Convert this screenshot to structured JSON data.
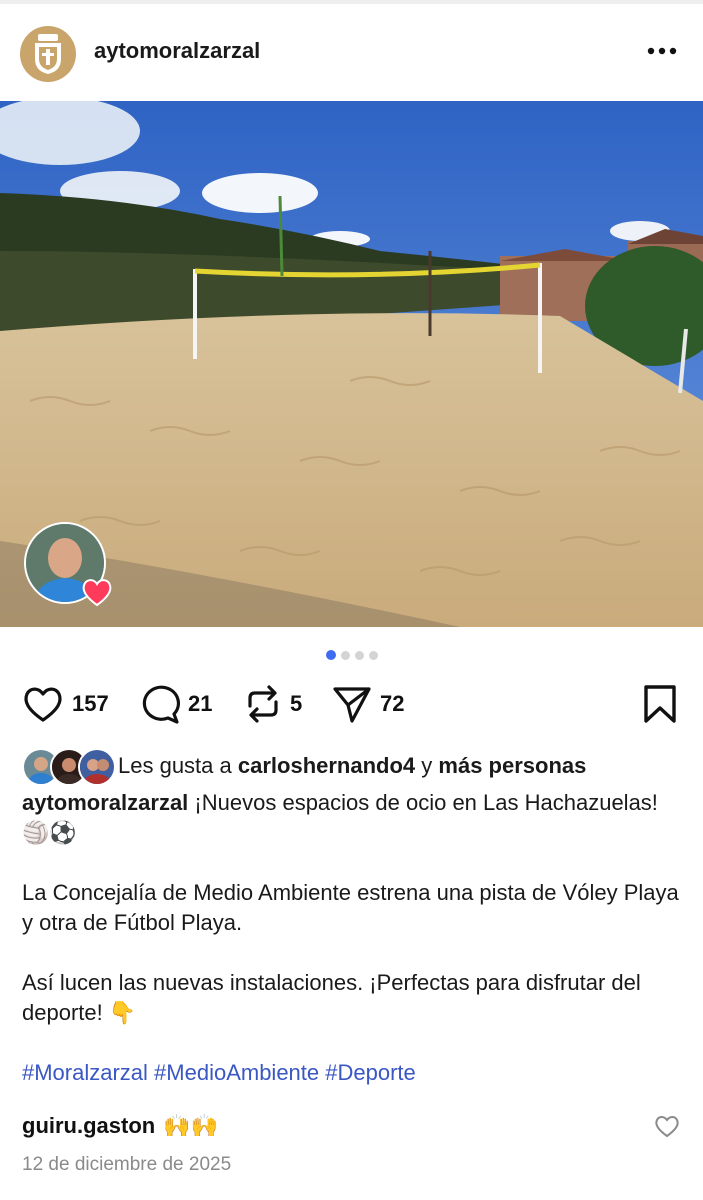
{
  "post": {
    "username": "aytomoralzarzal",
    "more_icon": "ellipsis-icon",
    "media": {
      "slide_count": 4,
      "active_slide": 1
    },
    "actions": {
      "likes": "157",
      "comments": "21",
      "reposts": "5",
      "shares": "72"
    },
    "liked_by": {
      "prefix": "Les gusta a",
      "user": "carloshernando4",
      "connector": "y",
      "others": "más personas"
    },
    "caption": {
      "username": "aytomoralzarzal",
      "line1": "¡Nuevos espacios de ocio en Las Hachazuelas! 🏐⚽",
      "line2": "La Concejalía de Medio Ambiente estrena una pista de Vóley Playa y otra de Fútbol Playa.",
      "line3": "Así lucen las nuevas instalaciones. ¡Perfectas para disfrutar del deporte! 👇",
      "hashtags": "#Moralzarzal #MedioAmbiente #Deporte"
    },
    "comment": {
      "username": "guiru.gaston",
      "text": "🙌🙌"
    },
    "date": "12 de diciembre de 2025"
  },
  "colors": {
    "accent": "#3f6bf0",
    "hashtag": "#3a57c4",
    "avatar_bg": "#c9a56b",
    "heart_badge": "#ff3b5c"
  }
}
